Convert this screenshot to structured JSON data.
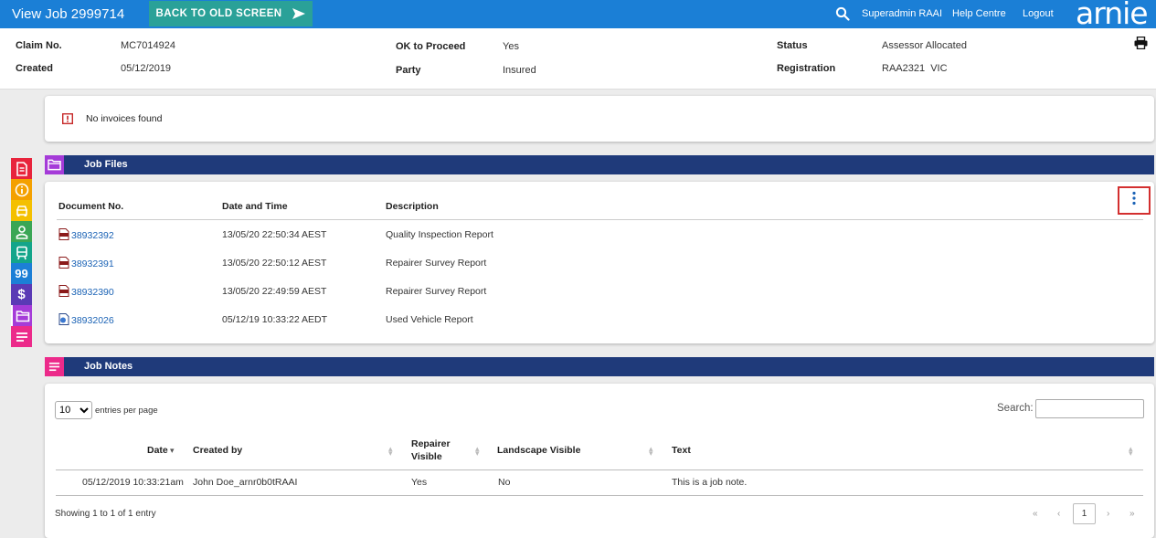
{
  "topbar": {
    "title": "View Job 2999714",
    "back_label": "BACK TO OLD SCREEN",
    "user": "Superadmin RAAI",
    "help": "Help Centre",
    "logout": "Logout",
    "logo": "arnie"
  },
  "header": {
    "claim_label": "Claim No.",
    "claim_value": "MC7014924",
    "created_label": "Created",
    "created_value": "05/12/2019",
    "ok_label": "OK to Proceed",
    "ok_value": "Yes",
    "party_label": "Party",
    "party_value": "Insured",
    "status_label": "Status",
    "status_value": "Assessor Allocated",
    "reg_label": "Registration",
    "reg_value": "RAA2321  VIC"
  },
  "invoices": {
    "message": "No invoices found"
  },
  "job_files": {
    "title": "Job Files",
    "columns": [
      "Document No.",
      "Date and Time",
      "Description"
    ],
    "rows": [
      {
        "doc": "38932392",
        "date": "13/05/20 22:50:34 AEST",
        "desc": "Quality Inspection Report",
        "icon": "pdf-icon"
      },
      {
        "doc": "38932391",
        "date": "13/05/20 22:50:12 AEST",
        "desc": "Repairer Survey Report",
        "icon": "pdf-icon"
      },
      {
        "doc": "38932390",
        "date": "13/05/20 22:49:59 AEST",
        "desc": "Repairer Survey Report",
        "icon": "pdf-icon"
      },
      {
        "doc": "38932026",
        "date": "05/12/19 10:33:22 AEDT",
        "desc": "Used Vehicle Report",
        "icon": "web-doc-icon"
      }
    ]
  },
  "job_notes": {
    "title": "Job Notes",
    "entries_value": "10",
    "entries_label": "entries per page",
    "search_label": "Search:",
    "columns": [
      "Date",
      "Created by",
      "Repairer Visible",
      "Landscape Visible",
      "Text"
    ],
    "col_repairer_line1": "Repairer",
    "col_repairer_line2": "Visible",
    "rows": [
      {
        "date": "05/12/2019 10:33:21am",
        "created_by": "John Doe_arnr0b0tRAAI",
        "repairer": "Yes",
        "landscape": "No",
        "text": "This is a job note."
      }
    ],
    "showing": "Showing 1 to 1 of 1 entry",
    "pager": {
      "first": "«",
      "prev": "‹",
      "current": "1",
      "next": "›",
      "last": "»"
    }
  },
  "colors": {
    "topbar": "#1b7fd6",
    "back_button": "#2aa198",
    "section_bar": "#1f3a7a",
    "link": "#1a62b5",
    "highlight_box": "#d32f2f",
    "rail": [
      "#e8243c",
      "#f4a000",
      "#f4c000",
      "#3aa655",
      "#13a58a",
      "#1c7fd6",
      "#5a3ab5",
      "#a53bd8",
      "#ec2a8a"
    ]
  },
  "rail_icons": [
    "invoice-icon",
    "info-icon",
    "car-icon",
    "person-icon",
    "vehicle-icon",
    "quote-icon",
    "dollar-icon",
    "folder-icon",
    "notes-icon"
  ],
  "rail_text": {
    "quote": "99",
    "dollar": "$"
  }
}
